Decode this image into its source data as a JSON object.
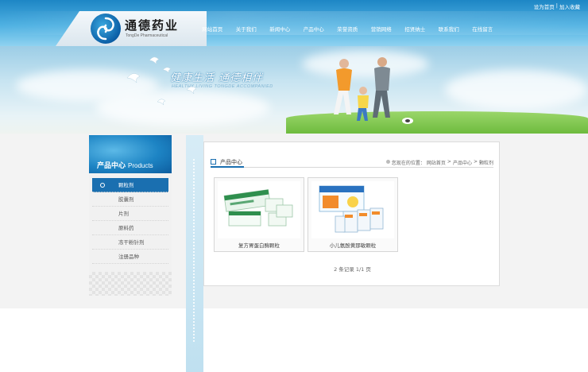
{
  "top_links": [
    "设为首页",
    "|",
    "加入收藏"
  ],
  "logo": {
    "cn": "通德药业",
    "en": "TongDe Pharmaceutical"
  },
  "nav": [
    "网站首页",
    "关于我们",
    "新闻中心",
    "产品中心",
    "荣誉资质",
    "营销网络",
    "招贤纳士",
    "联系我们",
    "在线留言"
  ],
  "banner": {
    "slogan": "健康生活  通德相伴",
    "slogan_en": "HEALTHY LIVING  TONGDE ACCOMPANIED"
  },
  "sidebar": {
    "title": "产品中心",
    "title_en": "Products",
    "items": [
      {
        "label": "颗粒剂",
        "active": true
      },
      {
        "label": "胶囊剂",
        "active": false
      },
      {
        "label": "片剂",
        "active": false
      },
      {
        "label": "原料药",
        "active": false
      },
      {
        "label": "冻干粉针剂",
        "active": false
      },
      {
        "label": "注册品种",
        "active": false
      }
    ]
  },
  "main": {
    "title": "产品中心",
    "breadcrumb_prefix": "您现在的位置：",
    "breadcrumb": [
      "网站首页",
      ">",
      "产品中心",
      ">",
      "颗粒剂"
    ],
    "products": [
      {
        "name": "复方胃蛋白酶颗粒"
      },
      {
        "name": "小儿氨酚黄那敏颗粒"
      }
    ],
    "pager": "2 条记录  1/1 页"
  },
  "colors": {
    "primary": "#1a6fb0",
    "header": "#1d86c5"
  }
}
